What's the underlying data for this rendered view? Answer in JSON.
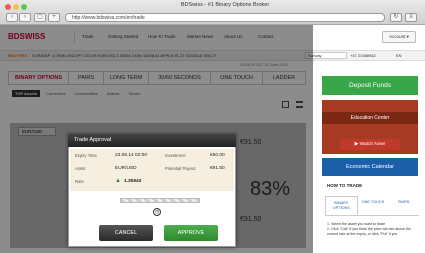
{
  "window": {
    "title": "BDSwiss - #1 Binary Options Broker",
    "url": "http://www.bdswiss.com/en/trade"
  },
  "logo": "BDSWISS",
  "nav": [
    "Trade",
    "Getting Started",
    "How To Trade",
    "Market News",
    "About Us",
    "Contact"
  ],
  "account_button": "Account",
  "ticker": {
    "label": "REUTERS",
    "items": "EUR/GBP -0.7898   USD/JPY 102.00   EUR/USD 1.35951   DOW 16928.51   APPLE 91.27   GOOGLE 556.27",
    "country": "Norway",
    "phone": "+47 21988982",
    "lang": "EN"
  },
  "timestamp": "01:03:29 CET 23 June 2014",
  "tabs": [
    "BINARY OPTIONS",
    "PAIRS",
    "LONG TERM",
    "30/60 SECONDS",
    "ONE TOUCH",
    "LADDER"
  ],
  "subtabs": [
    "TOP Assets",
    "Currencies",
    "Commodities",
    "Indices",
    "Stocks"
  ],
  "chart": {
    "asset": "EUR/USD",
    "price1": "€91.50",
    "percent": "83%",
    "price2": "€91.50"
  },
  "modal": {
    "title": "Trade Approval",
    "expiry_label": "Expiry Time",
    "expiry_value": "23.06.14 02:00",
    "investment_label": "Investment",
    "investment_value": "€50.00",
    "asset_label": "Asset",
    "asset_value": "EUR/USD",
    "payout_label": "Potential Payout",
    "payout_value": "€91.50",
    "rate_label": "Rate",
    "rate_value": "1.35943",
    "cancel": "CANCEL",
    "approve": "APPROVE"
  },
  "sidebar": {
    "deposit": "Deposit Funds",
    "education": "Education Center",
    "watch": "Watch Now!",
    "economic": "Economic Calendar",
    "howto": "HOW TO TRADE",
    "howto_tabs": [
      "BINARY OPTIONS",
      "ONE TOUCH",
      "PAIRS"
    ],
    "steps": [
      "1. Select the asset you want to trade",
      "2. Click \"Call\" if you think the price will rise above the current rate at the expiry, or click \"Put\" if you"
    ]
  },
  "colors": {
    "accent_red": "#cc1133",
    "green": "#3aa64a",
    "blue": "#1a5fa8"
  }
}
